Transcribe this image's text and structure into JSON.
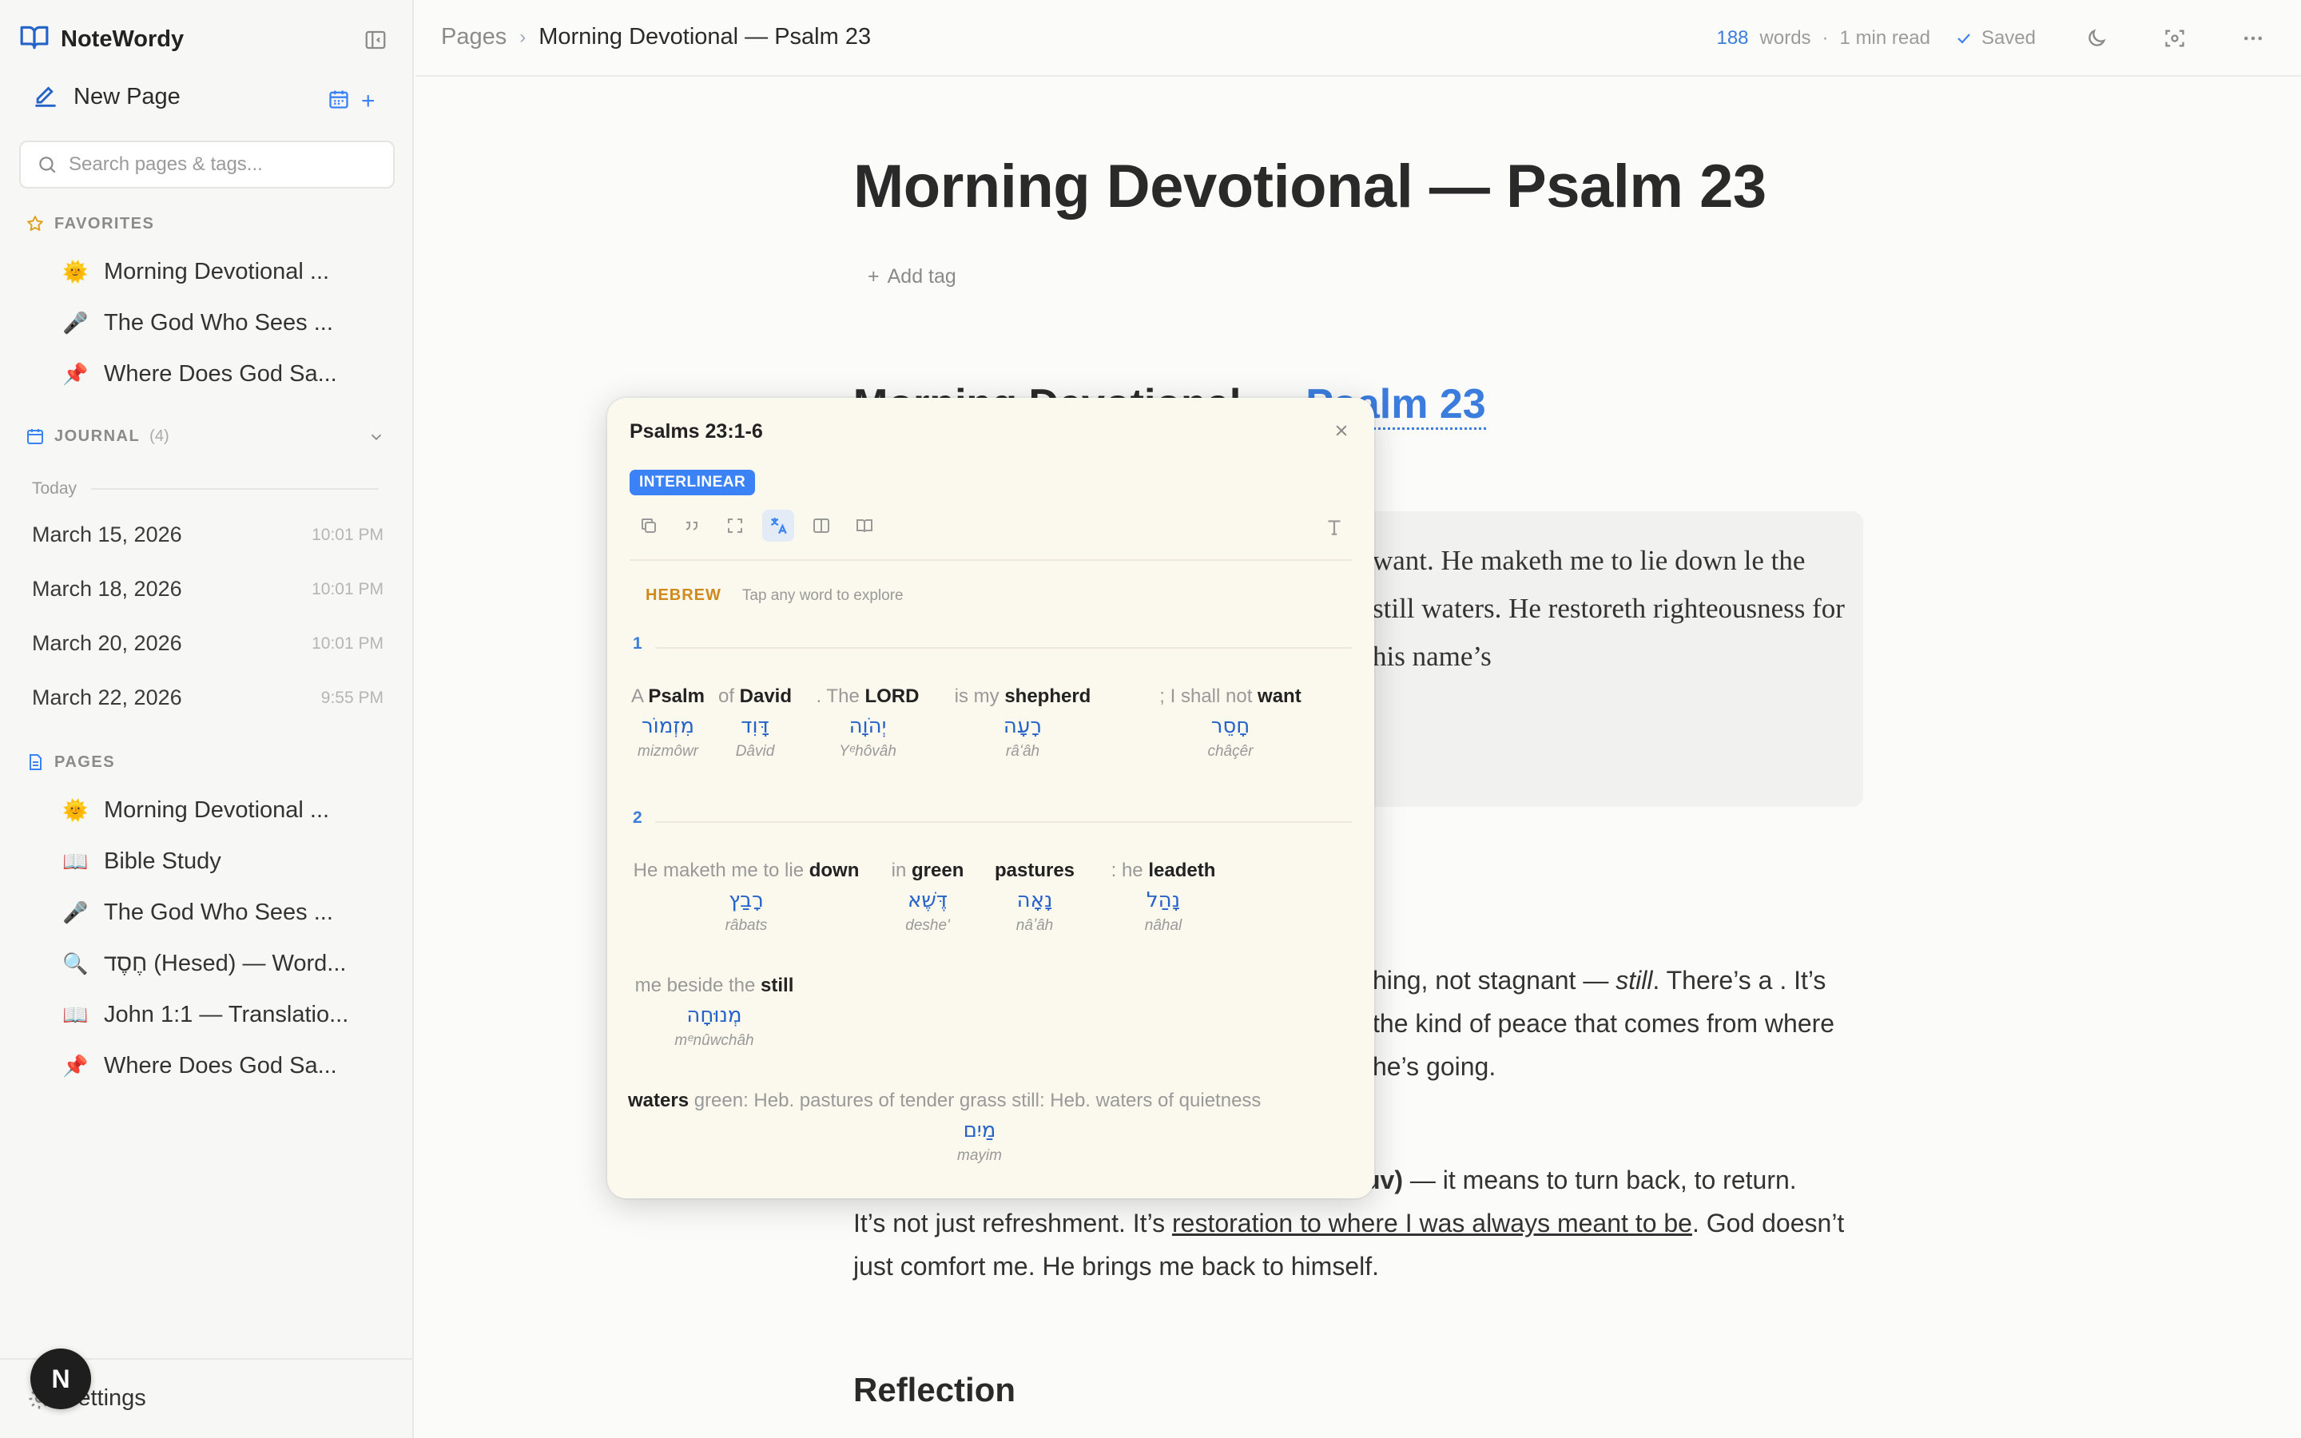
{
  "app": {
    "name": "NoteWordy"
  },
  "sidebar": {
    "new_page": "New Page",
    "search_placeholder": "Search pages & tags...",
    "favorites_label": "FAVORITES",
    "favorites": [
      {
        "emoji": "🌞",
        "label": "Morning Devotional ..."
      },
      {
        "emoji": "🎤",
        "label": "The God Who Sees ..."
      },
      {
        "emoji": "📌",
        "label": "Where Does God Sa..."
      }
    ],
    "journal_label": "JOURNAL",
    "journal_count": "(4)",
    "today_label": "Today",
    "journal": [
      {
        "date": "March 15, 2026",
        "time": "10:01 PM"
      },
      {
        "date": "March 18, 2026",
        "time": "10:01 PM"
      },
      {
        "date": "March 20, 2026",
        "time": "10:01 PM"
      },
      {
        "date": "March 22, 2026",
        "time": "9:55 PM"
      }
    ],
    "pages_label": "PAGES",
    "pages": [
      {
        "emoji": "🌞",
        "label": "Morning Devotional ..."
      },
      {
        "emoji": "📖",
        "label": "Bible Study"
      },
      {
        "emoji": "🎤",
        "label": "The God Who Sees ..."
      },
      {
        "emoji": "🔍",
        "label": "חֶסֶד (Hesed) — Word..."
      },
      {
        "emoji": "📖",
        "label": "John 1:1 — Translatio..."
      },
      {
        "emoji": "📌",
        "label": "Where Does God Sa..."
      }
    ],
    "settings": "Settings",
    "avatar_initial": "N"
  },
  "topbar": {
    "crumb_root": "Pages",
    "crumb_current": "Morning Devotional — Psalm 23",
    "word_count": "188",
    "words_label": "words",
    "dot": "·",
    "read_time": "1 min read",
    "saved": "Saved"
  },
  "main": {
    "title": "Morning Devotional — Psalm 23",
    "add_tag": "Add tag",
    "heading_prefix": "Morning Devotional — ",
    "heading_ref": "Psalm 23",
    "quote": "want. He maketh me to lie down le the still waters. He restoreth righteousness for his name’s",
    "para1_a": "hing, not stagnant — ",
    "para1_em": "still",
    "para1_b": ". There’s a . It’s the kind of peace that comes from where he’s going.",
    "para2_lead": "uv)",
    "para2_lead_rest": " — it means to turn back, to return.",
    "para2_a": "It’s not just refreshment. It’s ",
    "para2_link": "restoration to where I was always meant to be",
    "para2_b": ". God doesn’t just comfort me. He brings me back to himself.",
    "reflection": "Reflection"
  },
  "popup": {
    "title": "Psalms 23:1-6",
    "badge": "INTERLINEAR",
    "lang": "HEBREW",
    "hint": "Tap any word to explore",
    "verse1": "1",
    "verse2": "2",
    "words": [
      {
        "pre": "A ",
        "key": "Psalm",
        "heb": "מִזְמוֹר",
        "tr": "mizmôwr"
      },
      {
        "pre": "of ",
        "key": "David",
        "heb": "דָּוִד",
        "tr": "Dâvid"
      },
      {
        "pre": ". The ",
        "key": "LORD",
        "heb": "יְהֹוָה",
        "tr": "Yᵉhôvâh"
      },
      {
        "pre": "is my ",
        "key": "shepherd",
        "heb": "רָעָה",
        "tr": "râʻâh"
      },
      {
        "pre": "; I shall not ",
        "key": "want",
        "heb": "חָסֵר",
        "tr": "châçêr"
      },
      {
        "pre": "He maketh me to lie ",
        "key": "down",
        "heb": "רָבַץ",
        "tr": "râbats"
      },
      {
        "pre": "in ",
        "key": "green",
        "heb": "דֶּשֶׁא",
        "tr": "deshe'"
      },
      {
        "pre": "",
        "key": "pastures",
        "heb": "נָאָה",
        "tr": "nâʼâh"
      },
      {
        "pre": ": he ",
        "key": "leadeth",
        "heb": "נָהַל",
        "tr": "nâhal"
      },
      {
        "pre": "me beside the ",
        "key": "still",
        "heb": "מְנוּחָה",
        "tr": "mᵉnûwchâh"
      },
      {
        "pre": "",
        "key": "waters",
        "post": " green: Heb. pastures of tender grass still: Heb. waters of quietness",
        "heb": "מַיִם",
        "tr": "mayim"
      }
    ]
  },
  "colors": {
    "accent": "#3b82f6",
    "hebrew": "#2563c9",
    "lang_tag": "#d08a1c",
    "popup_bg": "#fbf8ee"
  }
}
